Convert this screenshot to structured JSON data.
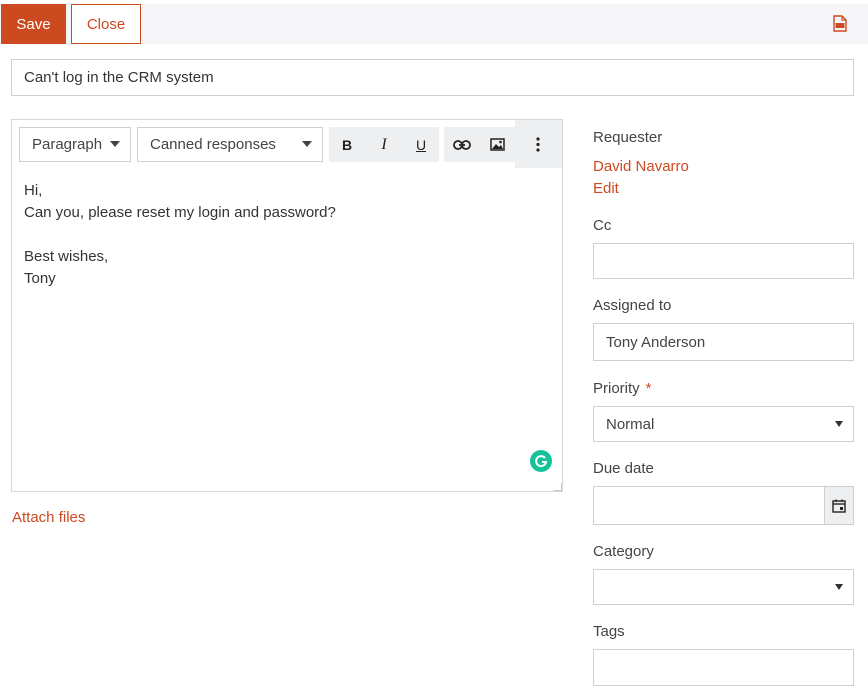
{
  "toolbar": {
    "save_label": "Save",
    "close_label": "Close",
    "export_icon": "pdf-icon"
  },
  "subject": {
    "value": "Can't log in the CRM system"
  },
  "editor": {
    "paragraph_select": "Paragraph",
    "canned_select": "Canned responses",
    "bold_label": "B",
    "italic_label": "I",
    "underline_label": "U",
    "body_lines": [
      "Hi,",
      "Can you, please reset my login and password?",
      "",
      "Best wishes,",
      "Tony"
    ]
  },
  "attach_label": "Attach files",
  "sidebar": {
    "requester_label": "Requester",
    "requester_name": "David Navarro",
    "requester_edit": "Edit",
    "cc_label": "Cc",
    "cc_value": "",
    "assigned_label": "Assigned to",
    "assigned_value": "Tony Anderson",
    "priority_label": "Priority",
    "priority_required": "*",
    "priority_value": "Normal",
    "due_label": "Due date",
    "due_value": "",
    "category_label": "Category",
    "category_value": "",
    "tags_label": "Tags",
    "tags_value": ""
  },
  "colors": {
    "accent": "#cc4a1f",
    "grammarly": "#15c39a"
  }
}
